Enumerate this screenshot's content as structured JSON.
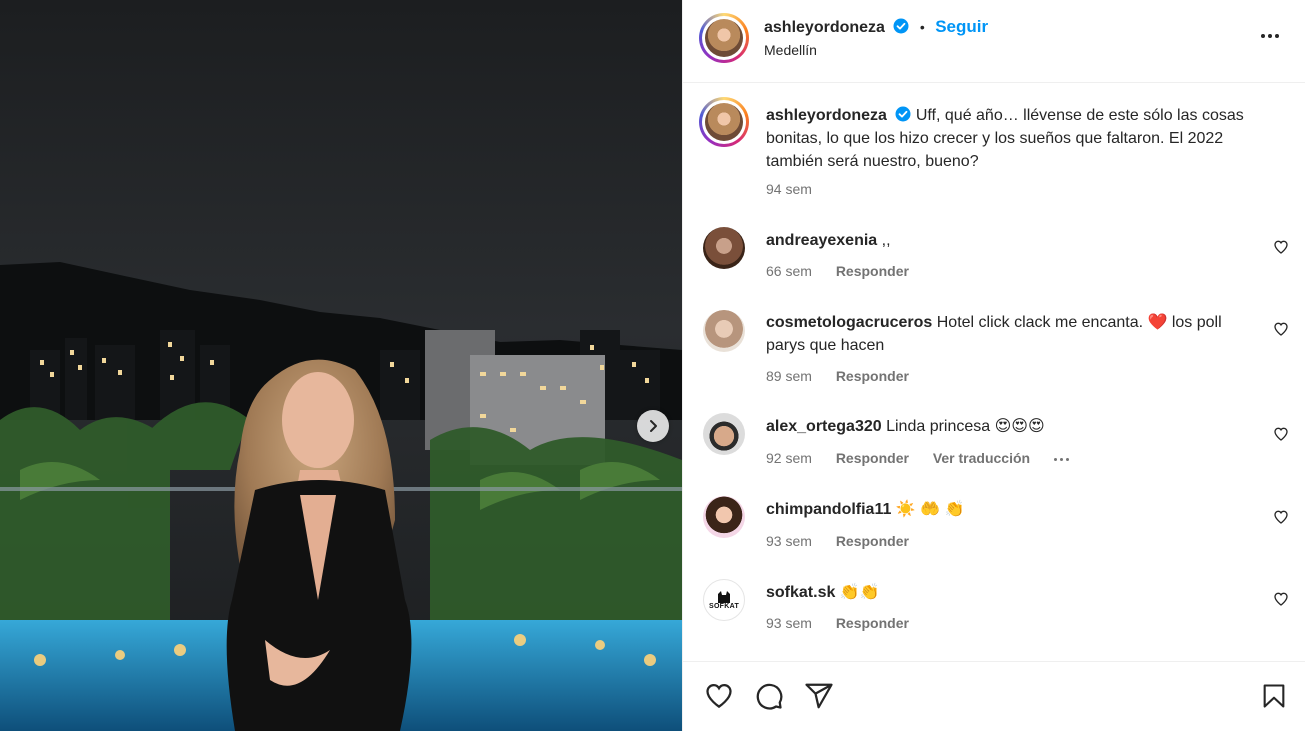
{
  "post": {
    "author": "ashleyordoneza",
    "follow_label": "Seguir",
    "separator": "•",
    "location": "Medellín",
    "caption": "Uff, qué año… llévense de este sólo las cosas bonitas, lo que los hizo crecer y los sueños que faltaron. El 2022 también será nuestro, bueno?",
    "caption_time": "94 sem"
  },
  "comments": [
    {
      "user": "andreayexenia",
      "text": ",,",
      "time": "66 sem",
      "reply": "Responder"
    },
    {
      "user": "cosmetologacruceros",
      "text": "Hotel click clack me encanta. ❤️ los poll parys que hacen",
      "time": "89 sem",
      "reply": "Responder"
    },
    {
      "user": "alex_ortega320",
      "text": "Linda princesa 😍😍😍",
      "time": "92 sem",
      "reply": "Responder",
      "translate": "Ver traducción"
    },
    {
      "user": "chimpandolfia11",
      "text": "☀️ 🤲 👏",
      "time": "93 sem",
      "reply": "Responder"
    },
    {
      "user": "sofkat.sk",
      "text": "👏👏",
      "time": "93 sem",
      "reply": "Responder",
      "avatar_text": "SOFKAT"
    }
  ],
  "colors": {
    "accent": "#0095f6",
    "verified": "#0095f6",
    "heart_red": "#ed4956",
    "muted_text": "#737373"
  },
  "icons": [
    "verified-badge-icon",
    "more-options-icon",
    "heart-icon",
    "comment-icon",
    "share-icon",
    "bookmark-icon",
    "chevron-right-icon"
  ]
}
